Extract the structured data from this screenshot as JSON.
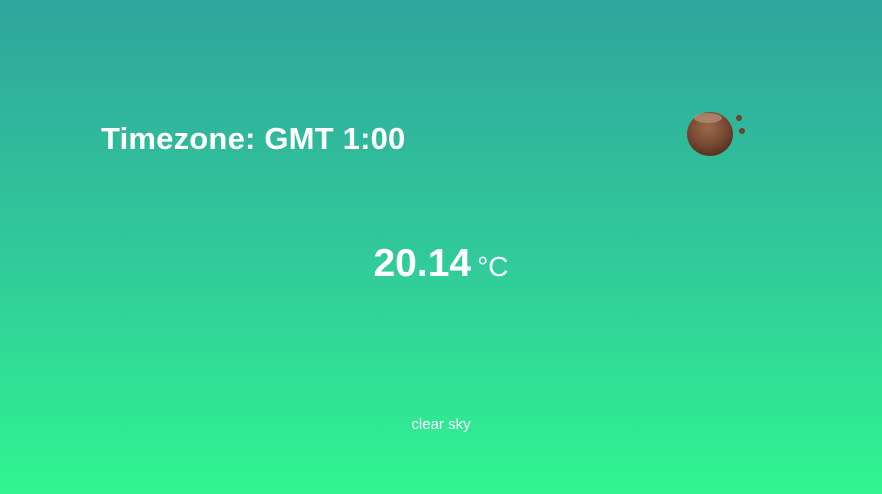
{
  "timezone": {
    "label": "Timezone: GMT 1:00"
  },
  "weather": {
    "icon": "clear-sky-icon",
    "temperature": "20.14",
    "unit": "°C",
    "description": "clear sky"
  },
  "colors": {
    "background_top": "#2fa59d",
    "background_bottom": "#30f590",
    "text": "#ffffff",
    "icon_primary": "#7a4b33"
  }
}
